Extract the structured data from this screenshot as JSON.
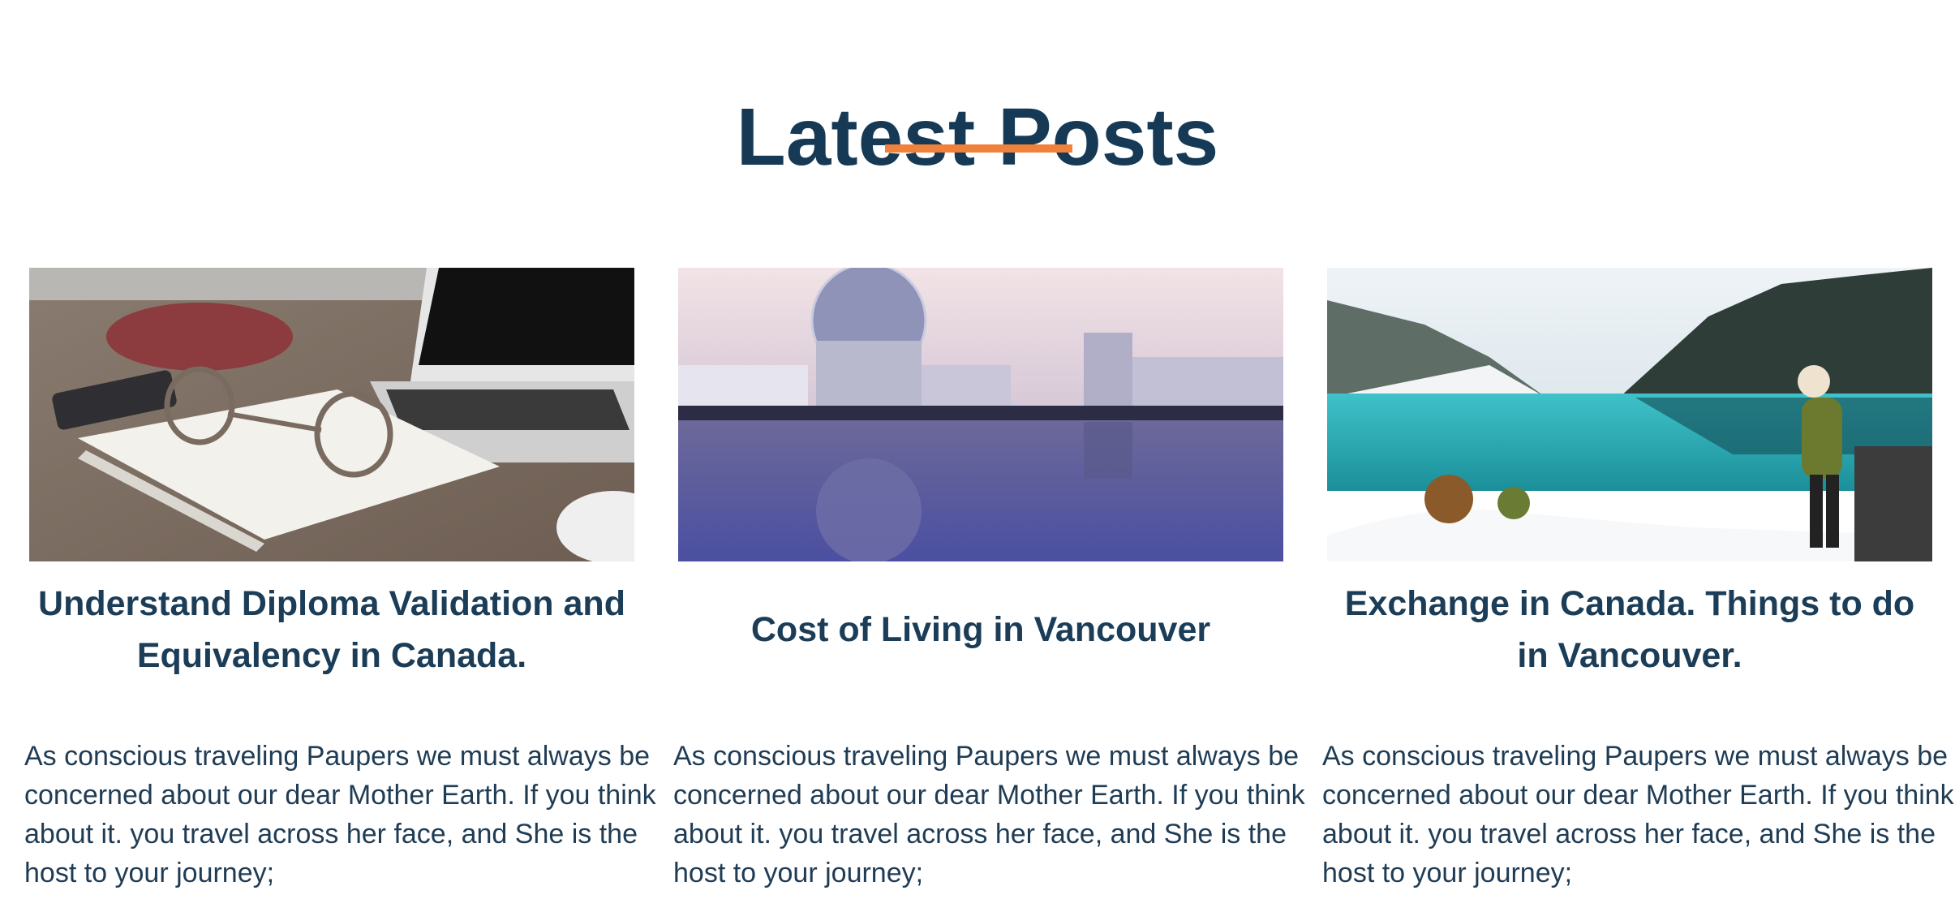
{
  "section": {
    "title": "Latest Posts"
  },
  "colors": {
    "heading": "#163a56",
    "accent": "#f0813a",
    "body_text": "#1f3c55"
  },
  "posts": [
    {
      "image_label": "desk-laptop-glasses-notebook-photo",
      "title": "Understand Diploma Validation and Equivalency in Canada.",
      "excerpt": "As conscious traveling Paupers we must always be concerned about our dear Mother Earth. If you think about it. you travel across her face, and She is the host to your journey;"
    },
    {
      "image_label": "vancouver-science-world-waterfront-photo",
      "title": "Cost of Living in Vancouver",
      "excerpt": "As conscious traveling Paupers we must always be concerned about our dear Mother Earth. If you think about it. you travel across her face, and She is the host to your journey;"
    },
    {
      "image_label": "mountain-lake-hiker-snow-photo",
      "title": "Exchange in Canada. Things to do in Vancouver.",
      "excerpt": "As conscious traveling Paupers we must always be concerned about our dear Mother Earth. If you think about it. you travel across her face, and She is the host to your journey;"
    }
  ]
}
